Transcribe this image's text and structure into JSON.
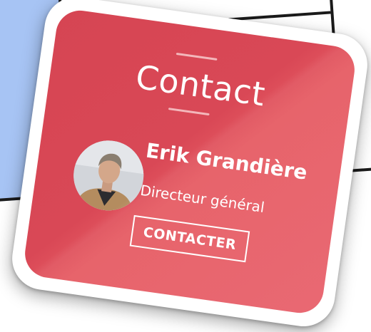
{
  "card": {
    "title": "Contact",
    "person_name": "Erik Grandière",
    "person_role": "Directeur général",
    "button_label": "CONTACTER"
  },
  "colors": {
    "card_background": "#d94856",
    "accent_line": "#f3b7bb",
    "text": "#ffffff",
    "side_tile": "#a7c4f4"
  },
  "icons": [
    "profile-photo"
  ]
}
